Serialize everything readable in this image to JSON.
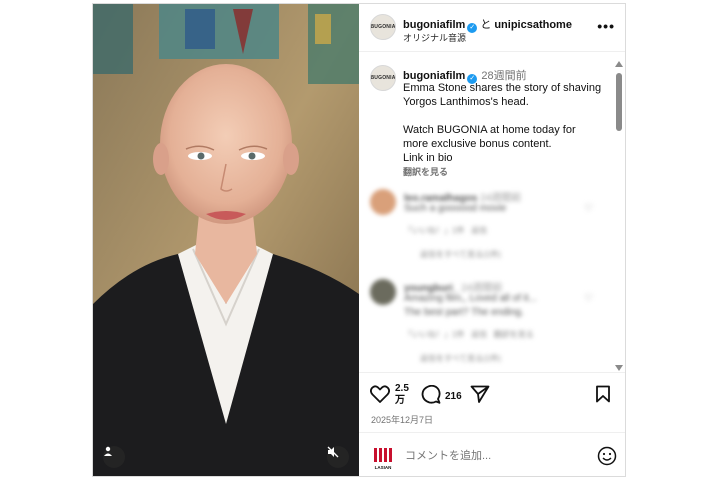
{
  "post_header": {
    "author": "bugoniafilm",
    "joiner": "と",
    "collaborator": "unipicsathome",
    "audio_label": "オリジナル音源"
  },
  "caption": {
    "author": "bugoniafilm",
    "time_ago": "28週間前",
    "text": "Emma Stone shares the story of shaving Yorgos Lanthimos's head.\n\nWatch BUGONIA at home today for more exclusive bonus content.\nLink in bio",
    "translate_label": "翻訳を見る"
  },
  "avatar_logo_text": "BUGONIA",
  "comments": [
    {
      "username": "leo.ramalhagos",
      "time": "24週間前",
      "text": "Such a goooood movie",
      "likes": "「いいね！」1件",
      "reply": "返信",
      "view_replies": "返信をすべて見る(1件)"
    },
    {
      "username": "youngburi_",
      "time": "24週間前",
      "text": "Amazing film,, Loved all of it...",
      "text2": "The best part? The ending.",
      "likes": "「いいね！」1件",
      "reply": "返信",
      "translate": "翻訳を見る",
      "view_replies": "返信をすべて見る(1件)"
    }
  ],
  "actions": {
    "like_count_line1": "2.5",
    "like_count_line2": "万",
    "comment_count": "216",
    "date": "2025年12月7日"
  },
  "composer": {
    "placeholder": "コメントを追加...",
    "profile_logo": "LASIAN"
  },
  "icons": {
    "verified": "verified-badge-icon",
    "more": "more-options-icon",
    "like": "heart-icon",
    "comment": "comment-icon",
    "share": "send-icon",
    "save": "bookmark-icon",
    "emoji": "emoji-icon",
    "user_tag": "user-tag-icon",
    "mute": "muted-speaker-icon"
  },
  "colors": {
    "verified": "#1d9bf0",
    "meta_text": "#737373",
    "border": "#dbdbdb"
  }
}
